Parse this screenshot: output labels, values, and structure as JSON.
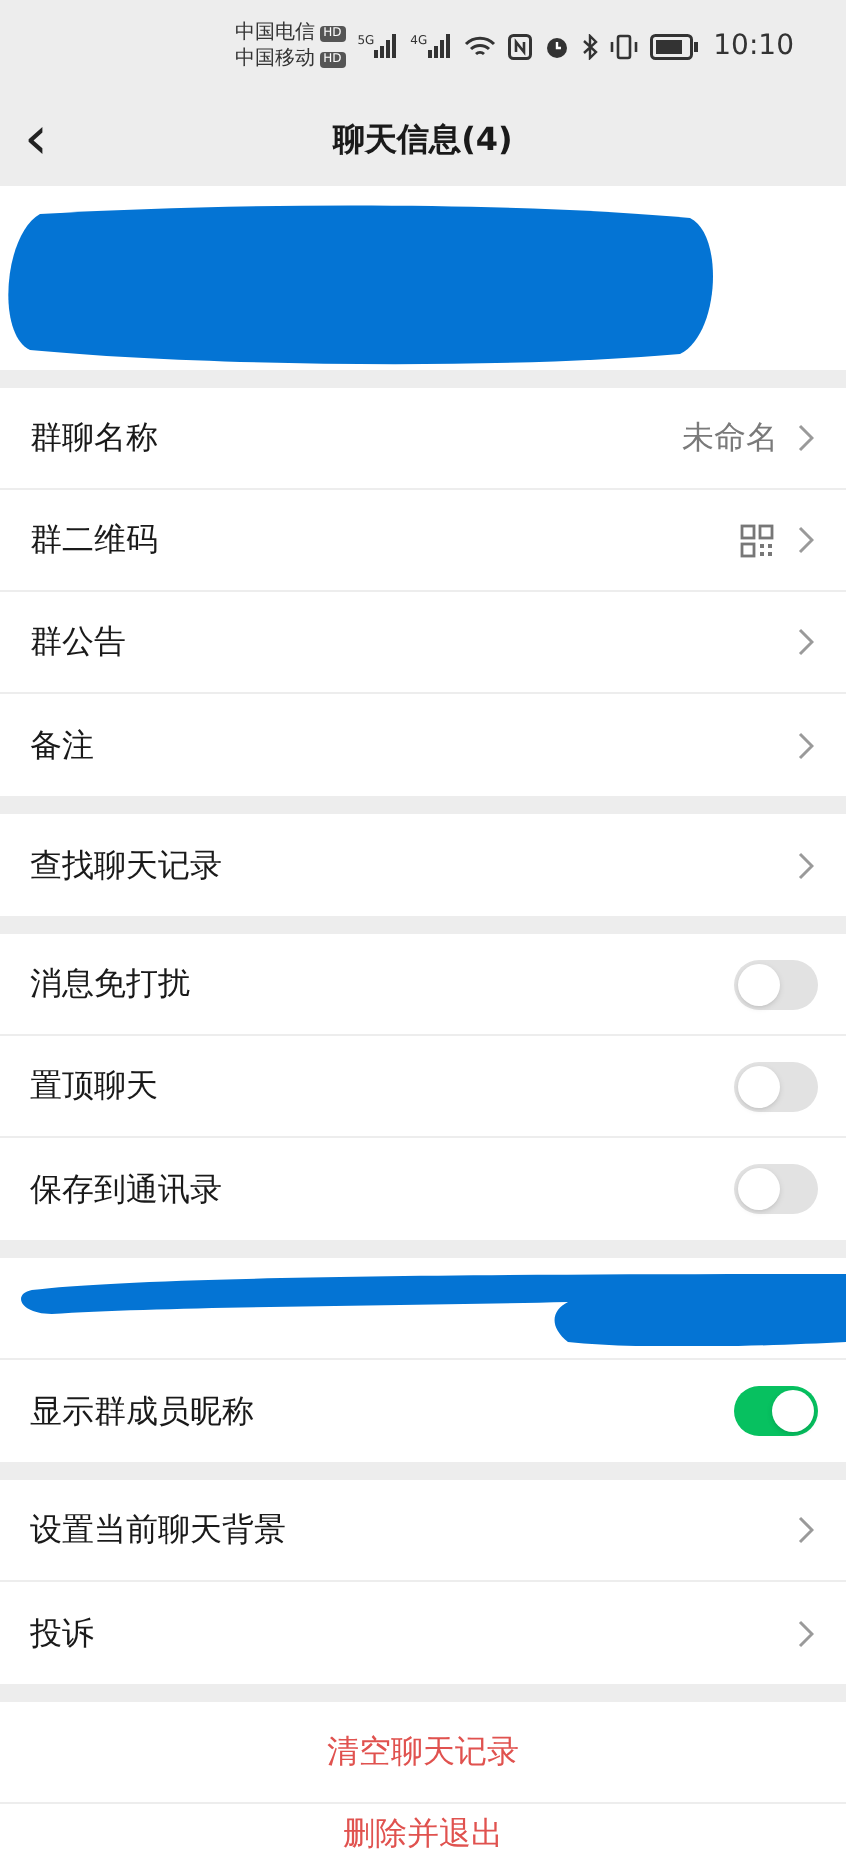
{
  "status_bar": {
    "carriers": [
      {
        "name": "中国电信",
        "badge": "HD"
      },
      {
        "name": "中国移动",
        "badge": "HD"
      }
    ],
    "networks": [
      "5G",
      "4G"
    ],
    "time": "10:10"
  },
  "header": {
    "back": "‹",
    "title": "聊天信息(4)"
  },
  "members": {
    "kind": "redacted"
  },
  "groups": [
    [
      {
        "kind": "link",
        "label": "群聊名称",
        "value": "未命名"
      },
      {
        "kind": "qr",
        "label": "群二维码"
      },
      {
        "kind": "link",
        "label": "群公告"
      },
      {
        "kind": "link",
        "label": "备注"
      }
    ],
    [
      {
        "kind": "link",
        "label": "查找聊天记录"
      }
    ],
    [
      {
        "kind": "toggle",
        "label": "消息免打扰",
        "on": false
      },
      {
        "kind": "toggle",
        "label": "置顶聊天",
        "on": false
      },
      {
        "kind": "toggle",
        "label": "保存到通讯录",
        "on": false
      }
    ],
    [
      {
        "kind": "redacted"
      },
      {
        "kind": "toggle",
        "label": "显示群成员昵称",
        "on": true
      }
    ],
    [
      {
        "kind": "link",
        "label": "设置当前聊天背景"
      },
      {
        "kind": "link",
        "label": "投诉"
      }
    ],
    [
      {
        "kind": "action",
        "label": "清空聊天记录"
      },
      {
        "kind": "action",
        "label": "删除并退出"
      }
    ]
  ]
}
